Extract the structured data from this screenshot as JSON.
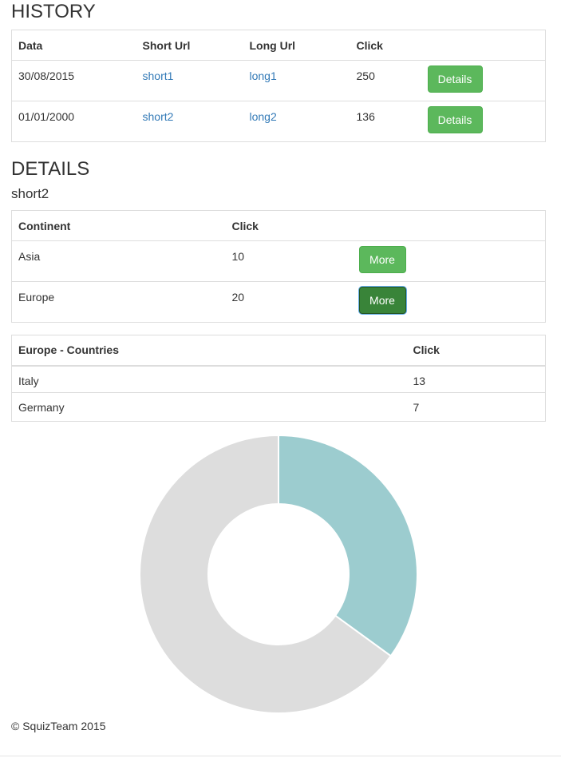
{
  "history": {
    "title": "HISTORY",
    "columns": [
      "Data",
      "Short Url",
      "Long Url",
      "Click",
      ""
    ],
    "rows": [
      {
        "date": "30/08/2015",
        "short": "short1",
        "long": "long1",
        "click": "250",
        "button": "Details"
      },
      {
        "date": "01/01/2000",
        "short": "short2",
        "long": "long2",
        "click": "136",
        "button": "Details"
      }
    ]
  },
  "details": {
    "title": "DETAILS",
    "selected": "short2",
    "columns": [
      "Continent",
      "Click",
      ""
    ],
    "rows": [
      {
        "continent": "Asia",
        "click": "10",
        "button": "More"
      },
      {
        "continent": "Europe",
        "click": "20",
        "button": "More"
      }
    ]
  },
  "countries": {
    "columns": [
      "Europe - Countries",
      "Click"
    ],
    "rows": [
      {
        "country": "Italy",
        "click": "13"
      },
      {
        "country": "Germany",
        "click": "7"
      }
    ]
  },
  "chart_data": {
    "type": "pie",
    "donut": true,
    "categories": [
      "Germany",
      "Italy"
    ],
    "values": [
      7,
      13
    ],
    "colors": [
      "#9ccccf",
      "#dddddd"
    ],
    "legend": "none",
    "title": ""
  },
  "colors": {
    "button_success": "#5cb85c",
    "button_active": "#398439",
    "link": "#337ab7"
  },
  "footer": {
    "text": "© SquizTeam 2015"
  }
}
